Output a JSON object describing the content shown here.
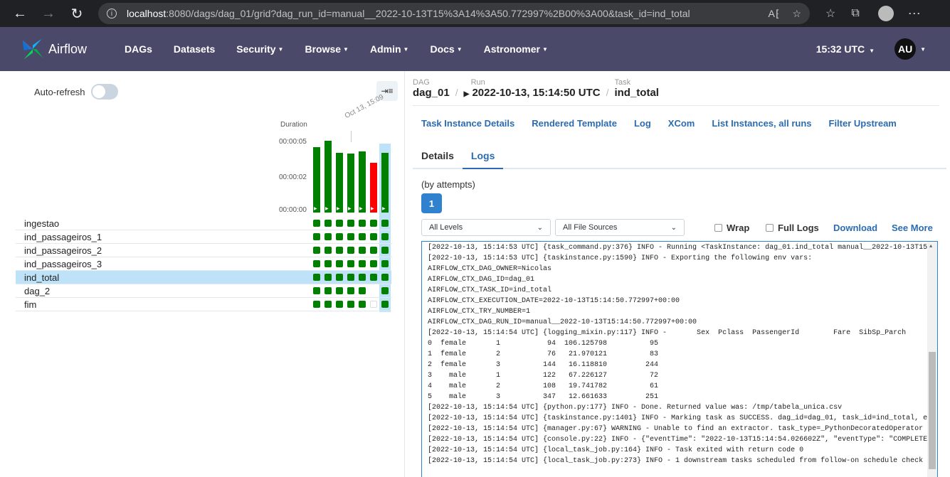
{
  "browser": {
    "url_host": "localhost",
    "url_rest": ":8080/dags/dag_01/grid?dag_run_id=manual__2022-10-13T15%3A14%3A50.772997%2B00%3A00&task_id=ind_total"
  },
  "navbar": {
    "brand": "Airflow",
    "menu": [
      {
        "label": "DAGs",
        "caret": false
      },
      {
        "label": "Datasets",
        "caret": false
      },
      {
        "label": "Security",
        "caret": true
      },
      {
        "label": "Browse",
        "caret": true
      },
      {
        "label": "Admin",
        "caret": true
      },
      {
        "label": "Docs",
        "caret": true
      },
      {
        "label": "Astronomer",
        "caret": true
      }
    ],
    "clock": "15:32 UTC",
    "avatar": "AU"
  },
  "grid": {
    "auto_refresh_label": "Auto-refresh",
    "duration_label": "Duration",
    "date_label": "Oct 13, 15:09",
    "axis_labels": [
      "00:00:05",
      "00:00:02",
      "00:00:00"
    ],
    "bar_max_seconds": 6,
    "runs": [
      {
        "duration": 5.0,
        "state": "success",
        "color": "#008000"
      },
      {
        "duration": 5.5,
        "state": "success",
        "color": "#008000"
      },
      {
        "duration": 4.6,
        "state": "success",
        "color": "#008000"
      },
      {
        "duration": 4.5,
        "state": "success",
        "color": "#008000"
      },
      {
        "duration": 4.7,
        "state": "success",
        "color": "#008000"
      },
      {
        "duration": 3.8,
        "state": "failed",
        "color": "#ff0000"
      },
      {
        "duration": 4.6,
        "state": "success",
        "color": "#008000"
      }
    ],
    "tasks": [
      {
        "name": "ingestao",
        "cells": [
          "s",
          "s",
          "s",
          "s",
          "s",
          "s",
          "s"
        ]
      },
      {
        "name": "ind_passageiros_1",
        "cells": [
          "s",
          "s",
          "s",
          "s",
          "s",
          "s",
          "s"
        ]
      },
      {
        "name": "ind_passageiros_2",
        "cells": [
          "s",
          "s",
          "s",
          "s",
          "s",
          "s",
          "s"
        ]
      },
      {
        "name": "ind_passageiros_3",
        "cells": [
          "s",
          "s",
          "s",
          "s",
          "s",
          "s",
          "s"
        ]
      },
      {
        "name": "ind_total",
        "cells": [
          "s",
          "s",
          "s",
          "s",
          "s",
          "s",
          "s"
        ],
        "selected": true
      },
      {
        "name": "dag_2",
        "cells": [
          "s",
          "s",
          "s",
          "s",
          "s",
          "n",
          "s"
        ]
      },
      {
        "name": "fim",
        "cells": [
          "s",
          "s",
          "s",
          "s",
          "s",
          "e",
          "s"
        ]
      }
    ]
  },
  "breadcrumb": {
    "dag_label": "DAG",
    "dag_value": "dag_01",
    "run_label": "Run",
    "run_value": "2022-10-13, 15:14:50 UTC",
    "task_label": "Task",
    "task_value": "ind_total"
  },
  "task_links": [
    "Task Instance Details",
    "Rendered Template",
    "Log",
    "XCom",
    "List Instances, all runs",
    "Filter Upstream"
  ],
  "tabs": [
    "Details",
    "Logs"
  ],
  "logs": {
    "attempts_label": "(by attempts)",
    "attempt": "1",
    "levels_select": "All Levels",
    "sources_select": "All File Sources",
    "wrap_label": "Wrap",
    "full_logs_label": "Full Logs",
    "download_label": "Download",
    "see_more_label": "See More",
    "lines": [
      "[2022-10-13, 15:14:53 UTC] {task_command.py:376} INFO - Running <TaskInstance: dag_01.ind_total manual__2022-10-13T15:14:",
      "[2022-10-13, 15:14:53 UTC] {taskinstance.py:1590} INFO - Exporting the following env vars:",
      "AIRFLOW_CTX_DAG_OWNER=Nicolas",
      "AIRFLOW_CTX_DAG_ID=dag_01",
      "AIRFLOW_CTX_TASK_ID=ind_total",
      "AIRFLOW_CTX_EXECUTION_DATE=2022-10-13T15:14:50.772997+00:00",
      "AIRFLOW_CTX_TRY_NUMBER=1",
      "AIRFLOW_CTX_DAG_RUN_ID=manual__2022-10-13T15:14:50.772997+00:00",
      "[2022-10-13, 15:14:54 UTC] {logging_mixin.py:117} INFO -       Sex  Pclass  PassengerId        Fare  SibSp_Parch",
      "0  female       1           94  106.125798          95",
      "1  female       2           76   21.970121          83",
      "2  female       3          144   16.118810         244",
      "3    male       1          122   67.226127          72",
      "4    male       2          108   19.741782          61",
      "5    male       3          347   12.661633         251",
      "[2022-10-13, 15:14:54 UTC] {python.py:177} INFO - Done. Returned value was: /tmp/tabela_unica.csv",
      "[2022-10-13, 15:14:54 UTC] {taskinstance.py:1401} INFO - Marking task as SUCCESS. dag_id=dag_01, task_id=ind_total, execu",
      "[2022-10-13, 15:14:54 UTC] {manager.py:67} WARNING - Unable to find an extractor. task_type=_PythonDecoratedOperator airf",
      "[2022-10-13, 15:14:54 UTC] {console.py:22} INFO - {\"eventTime\": \"2022-10-13T15:14:54.026602Z\", \"eventType\": \"COMPLETE\", \"",
      "[2022-10-13, 15:14:54 UTC] {local_task_job.py:164} INFO - Task exited with return code 0",
      "[2022-10-13, 15:14:54 UTC] {local_task_job.py:273} INFO - 1 downstream tasks scheduled from follow-on schedule check"
    ]
  }
}
